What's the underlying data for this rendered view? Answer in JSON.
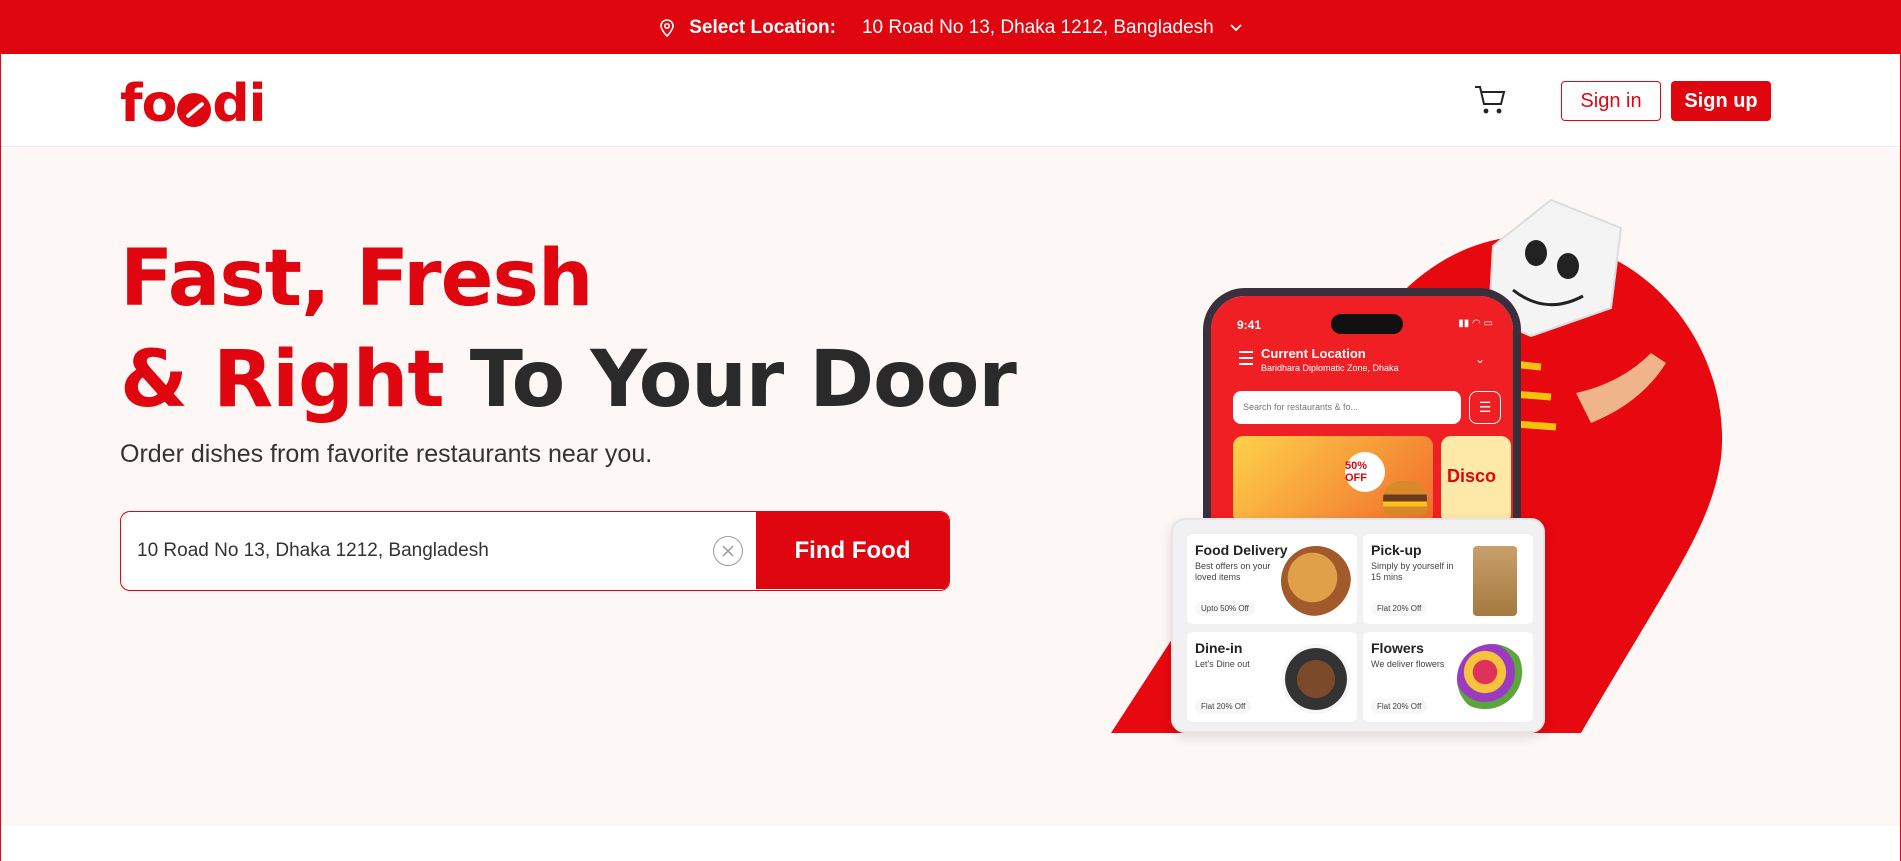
{
  "topbar": {
    "label": "Select Location:",
    "address": "10 Road No 13, Dhaka 1212, Bangladesh"
  },
  "header": {
    "logo": "foodi",
    "signin_label": "Sign in",
    "signup_label": "Sign up"
  },
  "hero": {
    "line1": "Fast, Fresh",
    "line2_red": "& Right",
    "line2_rest": " To Your Door",
    "subtitle": "Order dishes from favorite restaurants near you.",
    "search_value": "10 Road No 13, Dhaka 1212, Bangladesh",
    "find_label": "Find Food"
  },
  "phone": {
    "time": "9:41",
    "current_location": "Current Location",
    "address": "Baridhara Diplomatic Zone, Dhaka",
    "search_placeholder": "Search for restaurants & fo...",
    "promo_badge": "50% OFF",
    "promo2": "Disco",
    "services": [
      {
        "title": "Food Delivery",
        "desc": "Best offers on your loved items",
        "tag": "Upto 50% Off"
      },
      {
        "title": "Pick-up",
        "desc": "Simply by yourself in 15 mins",
        "tag": "Flat 20% Off"
      },
      {
        "title": "Dine-in",
        "desc": "Let's Dine out",
        "tag": "Flat 20% Off"
      },
      {
        "title": "Flowers",
        "desc": "We deliver flowers",
        "tag": "Flat 20% Off"
      }
    ]
  },
  "colors": {
    "brand": "#e0060f",
    "hero_bg": "#fdf7f6"
  }
}
